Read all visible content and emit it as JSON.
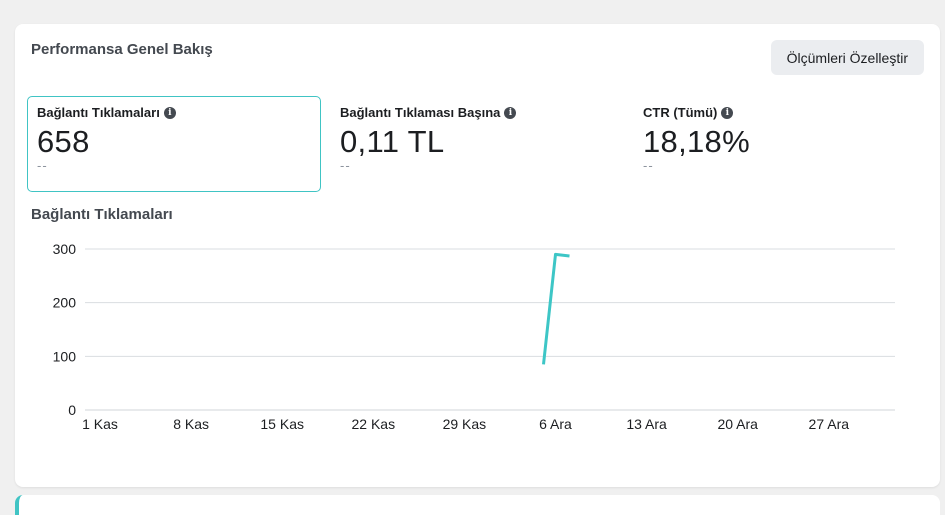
{
  "card": {
    "title": "Performansa Genel Bakış",
    "customize_button": "Ölçümleri Özelleştir"
  },
  "metrics": [
    {
      "label": "Bağlantı Tıklamaları",
      "value": "658",
      "delta": "--",
      "selected": true
    },
    {
      "label": "Bağlantı Tıklaması Başına",
      "value": "0,11 TL",
      "delta": "--",
      "selected": false
    },
    {
      "label": "CTR (Tümü)",
      "value": "18,18%",
      "delta": "--",
      "selected": false
    }
  ],
  "info_icon": "info-icon",
  "chart_data": {
    "type": "line",
    "title": "Bağlantı Tıklamaları",
    "xlabel": "",
    "ylabel": "",
    "x_ticks": [
      "1 Kas",
      "8 Kas",
      "15 Kas",
      "22 Kas",
      "29 Kas",
      "6 Ara",
      "13 Ara",
      "20 Ara",
      "27 Ara"
    ],
    "y_ticks": [
      0,
      100,
      200,
      300
    ],
    "ylim": [
      0,
      300
    ],
    "grid": true,
    "series": [
      {
        "color": "#3dc6c6",
        "points": [
          [
            "6 Ara",
            85
          ],
          [
            "6 Ara",
            290
          ],
          [
            "6 Ara",
            287
          ]
        ]
      }
    ]
  },
  "colors": {
    "accent": "#40c4c4",
    "line": "#3dc6c6",
    "grid": "#dadde1"
  }
}
